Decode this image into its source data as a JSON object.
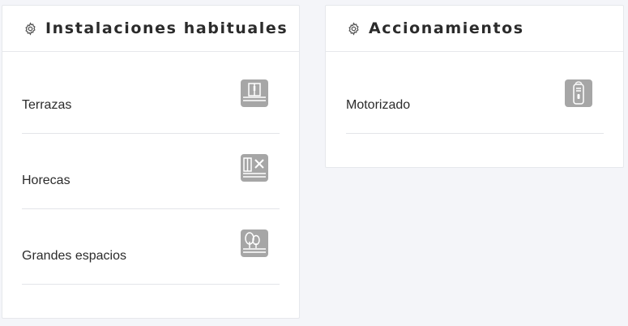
{
  "panels": [
    {
      "title": "Instalaciones habituales",
      "items": [
        {
          "label": "Terrazas",
          "icon": "terrace-icon"
        },
        {
          "label": "Horecas",
          "icon": "restaurant-icon"
        },
        {
          "label": "Grandes espacios",
          "icon": "trees-icon"
        }
      ]
    },
    {
      "title": "Accionamientos",
      "items": [
        {
          "label": "Motorizado",
          "icon": "remote-control-icon"
        }
      ]
    }
  ],
  "colors": {
    "background": "#f4f5f9",
    "card": "#ffffff",
    "icon": "#a6a6a6",
    "text": "#2b2b2b"
  }
}
